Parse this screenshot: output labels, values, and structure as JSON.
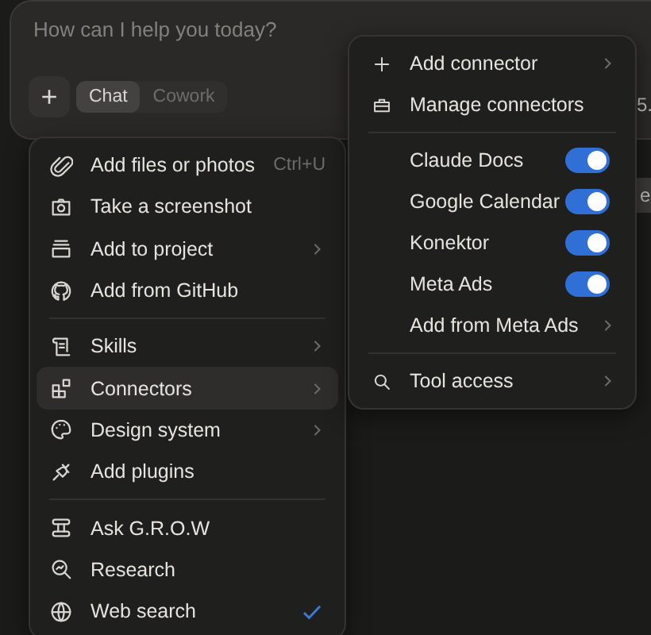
{
  "prompt": {
    "placeholder": "How can I help you today?"
  },
  "add_button": {
    "label": "+"
  },
  "modes": [
    {
      "label": "Chat",
      "selected": true
    },
    {
      "label": "Cowork",
      "selected": false
    }
  ],
  "background_texts": [
    "5.",
    "e"
  ],
  "menu": {
    "sections": [
      [
        {
          "label": "Add files or photos",
          "shortcut": "Ctrl+U",
          "submenu": false,
          "highlighted": false,
          "checked": false
        },
        {
          "label": "Take a screenshot",
          "submenu": false,
          "highlighted": false,
          "checked": false
        },
        {
          "label": "Add to project",
          "submenu": true,
          "highlighted": false,
          "checked": false
        },
        {
          "label": "Add from GitHub",
          "submenu": false,
          "highlighted": false,
          "checked": false
        }
      ],
      [
        {
          "label": "Skills",
          "submenu": true,
          "highlighted": false,
          "checked": false
        },
        {
          "label": "Connectors",
          "submenu": true,
          "highlighted": true,
          "checked": false
        },
        {
          "label": "Design system",
          "submenu": true,
          "highlighted": false,
          "checked": false
        },
        {
          "label": "Add plugins",
          "submenu": false,
          "highlighted": false,
          "checked": false
        }
      ],
      [
        {
          "label": "Ask G.R.O.W",
          "submenu": false,
          "highlighted": false,
          "checked": false
        },
        {
          "label": "Research",
          "submenu": false,
          "highlighted": false,
          "checked": false
        },
        {
          "label": "Web search",
          "submenu": false,
          "highlighted": false,
          "checked": true
        }
      ]
    ]
  },
  "connectors_menu": {
    "sections": [
      [
        {
          "kind": "action",
          "label": "Add connector",
          "submenu": true
        },
        {
          "kind": "action",
          "label": "Manage connectors",
          "submenu": false
        }
      ],
      [
        {
          "kind": "toggle",
          "label": "Claude Docs",
          "on": true
        },
        {
          "kind": "toggle",
          "label": "Google Calendar",
          "on": true
        },
        {
          "kind": "toggle",
          "label": "Konektor",
          "on": true
        },
        {
          "kind": "toggle",
          "label": "Meta Ads",
          "on": true
        },
        {
          "kind": "action",
          "label": "Add from Meta Ads",
          "submenu": true
        }
      ],
      [
        {
          "kind": "action",
          "label": "Tool access",
          "submenu": true
        }
      ]
    ]
  }
}
